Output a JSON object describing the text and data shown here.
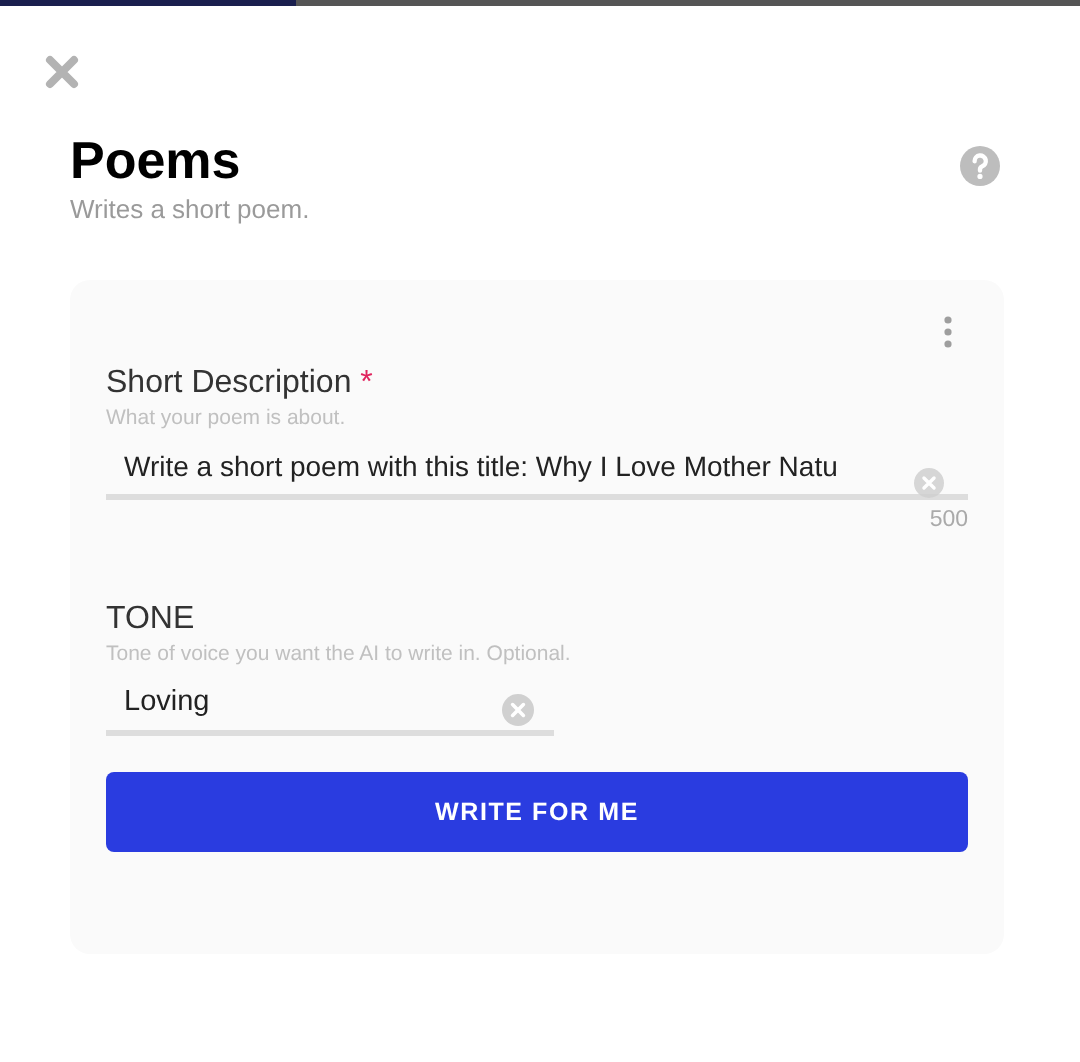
{
  "dialog": {
    "title": "Poems",
    "subtitle": "Writes a short poem."
  },
  "fields": [
    {
      "kind": "textarea",
      "label": "Short Description",
      "required_mark": "*",
      "hint": "What your poem is about.",
      "value": "Write a short poem with this title: Why I Love Mother Natu",
      "counter": "500"
    },
    {
      "kind": "text",
      "label": "TONE",
      "hint": "Tone of voice you want the AI to write in. Optional.",
      "value": "Loving"
    }
  ],
  "submit": {
    "label": "WRITE FOR ME"
  }
}
